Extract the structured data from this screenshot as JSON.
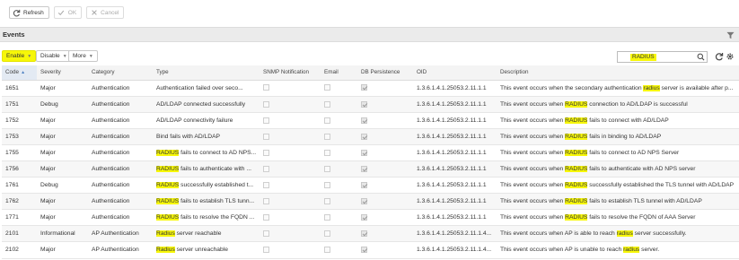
{
  "toolbar": {
    "refresh_label": "Refresh",
    "ok_label": "OK",
    "cancel_label": "Cancel"
  },
  "section": {
    "title": "Events"
  },
  "actions": {
    "enable_label": "Enable",
    "disable_label": "Disable",
    "more_label": "More"
  },
  "search": {
    "value": "RADIUS"
  },
  "colors": {
    "highlight": "#f7f709",
    "header_bg": "#ebebeb"
  },
  "table": {
    "columns": [
      "Code",
      "Severity",
      "Category",
      "Type",
      "SNMP Notification",
      "Email",
      "DB Persistence",
      "OID",
      "Description"
    ],
    "rows": [
      {
        "code": "1651",
        "severity": "Major",
        "category": "Authentication",
        "type": [
          {
            "t": "Authentication failed over seco..."
          }
        ],
        "snmp": false,
        "email": false,
        "db": true,
        "oid": "1.3.6.1.4.1.25053.2.11.1.1",
        "desc": [
          {
            "t": "This event occurs when the secondary authentication "
          },
          {
            "t": "radius",
            "h": true
          },
          {
            "t": " server is available after p..."
          }
        ]
      },
      {
        "code": "1751",
        "severity": "Debug",
        "category": "Authentication",
        "type": [
          {
            "t": "AD/LDAP connected successfully"
          }
        ],
        "snmp": false,
        "email": false,
        "db": true,
        "oid": "1.3.6.1.4.1.25053.2.11.1.1",
        "desc": [
          {
            "t": "This event occurs when "
          },
          {
            "t": "RADIUS",
            "h": true
          },
          {
            "t": " connection to AD/LDAP is successful"
          }
        ]
      },
      {
        "code": "1752",
        "severity": "Major",
        "category": "Authentication",
        "type": [
          {
            "t": "AD/LDAP connectivity failure"
          }
        ],
        "snmp": false,
        "email": false,
        "db": true,
        "oid": "1.3.6.1.4.1.25053.2.11.1.1",
        "desc": [
          {
            "t": "This event occurs when "
          },
          {
            "t": "RADIUS",
            "h": true
          },
          {
            "t": " fails to connect with AD/LDAP"
          }
        ]
      },
      {
        "code": "1753",
        "severity": "Major",
        "category": "Authentication",
        "type": [
          {
            "t": "Bind fails with AD/LDAP"
          }
        ],
        "snmp": false,
        "email": false,
        "db": true,
        "oid": "1.3.6.1.4.1.25053.2.11.1.1",
        "desc": [
          {
            "t": "This event occurs when "
          },
          {
            "t": "RADIUS",
            "h": true
          },
          {
            "t": " fails in binding to AD/LDAP"
          }
        ]
      },
      {
        "code": "1755",
        "severity": "Major",
        "category": "Authentication",
        "type": [
          {
            "t": "RADIUS",
            "h": true
          },
          {
            "t": " fails to connect to AD NPS..."
          }
        ],
        "snmp": false,
        "email": false,
        "db": true,
        "oid": "1.3.6.1.4.1.25053.2.11.1.1",
        "desc": [
          {
            "t": "This event occurs when "
          },
          {
            "t": "RADIUS",
            "h": true
          },
          {
            "t": " fails to connect to AD NPS Server"
          }
        ]
      },
      {
        "code": "1756",
        "severity": "Major",
        "category": "Authentication",
        "type": [
          {
            "t": "RADIUS",
            "h": true
          },
          {
            "t": " fails to authenticate with ..."
          }
        ],
        "snmp": false,
        "email": false,
        "db": true,
        "oid": "1.3.6.1.4.1.25053.2.11.1.1",
        "desc": [
          {
            "t": "This event occurs when "
          },
          {
            "t": "RADIUS",
            "h": true
          },
          {
            "t": " fails to authenticate with AD NPS server"
          }
        ]
      },
      {
        "code": "1761",
        "severity": "Debug",
        "category": "Authentication",
        "type": [
          {
            "t": "RADIUS",
            "h": true
          },
          {
            "t": " successfully established t..."
          }
        ],
        "snmp": false,
        "email": false,
        "db": true,
        "oid": "1.3.6.1.4.1.25053.2.11.1.1",
        "desc": [
          {
            "t": "This event occurs when "
          },
          {
            "t": "RADIUS",
            "h": true
          },
          {
            "t": " successfully established the TLS tunnel with AD/LDAP"
          }
        ]
      },
      {
        "code": "1762",
        "severity": "Major",
        "category": "Authentication",
        "type": [
          {
            "t": "RADIUS",
            "h": true
          },
          {
            "t": " fails to establish TLS tunn..."
          }
        ],
        "snmp": false,
        "email": false,
        "db": true,
        "oid": "1.3.6.1.4.1.25053.2.11.1.1",
        "desc": [
          {
            "t": "This event occurs when "
          },
          {
            "t": "RADIUS",
            "h": true
          },
          {
            "t": " fails to establish TLS tunnel with AD/LDAP"
          }
        ]
      },
      {
        "code": "1771",
        "severity": "Major",
        "category": "Authentication",
        "type": [
          {
            "t": "RADIUS",
            "h": true
          },
          {
            "t": " fails to resolve the FQDN ..."
          }
        ],
        "snmp": false,
        "email": false,
        "db": true,
        "oid": "1.3.6.1.4.1.25053.2.11.1.1",
        "desc": [
          {
            "t": "This event occurs when "
          },
          {
            "t": "RADIUS",
            "h": true
          },
          {
            "t": " fails to resolve the FQDN of AAA Server"
          }
        ]
      },
      {
        "code": "2101",
        "severity": "Informational",
        "category": "AP Authentication",
        "type": [
          {
            "t": "Radius",
            "h": true
          },
          {
            "t": " server reachable"
          }
        ],
        "snmp": false,
        "email": false,
        "db": true,
        "oid": "1.3.6.1.4.1.25053.2.11.1.4...",
        "desc": [
          {
            "t": "This event occurs when AP is able to reach "
          },
          {
            "t": "radius",
            "h": true
          },
          {
            "t": " server successfully."
          }
        ]
      },
      {
        "code": "2102",
        "severity": "Major",
        "category": "AP Authentication",
        "type": [
          {
            "t": "Radius",
            "h": true
          },
          {
            "t": " server unreachable"
          }
        ],
        "snmp": false,
        "email": false,
        "db": true,
        "oid": "1.3.6.1.4.1.25053.2.11.1.4...",
        "desc": [
          {
            "t": "This event occurs when AP is unable to reach "
          },
          {
            "t": "radius",
            "h": true
          },
          {
            "t": " server."
          }
        ]
      }
    ]
  }
}
